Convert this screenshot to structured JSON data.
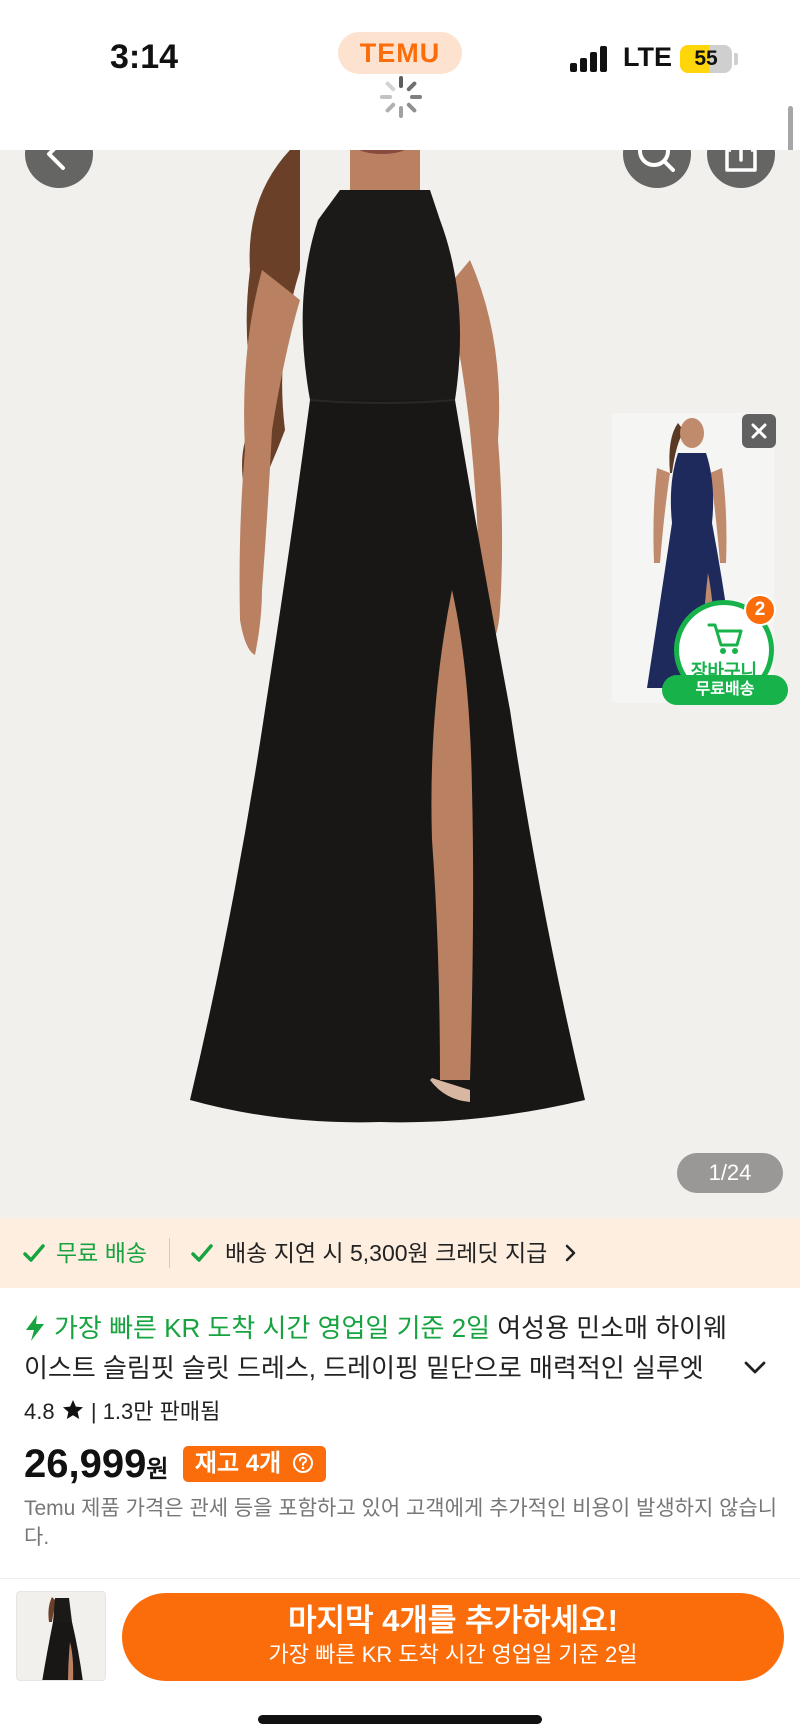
{
  "status_bar": {
    "time": "3:14",
    "brand": "TEMU",
    "network": "LTE",
    "battery": "55",
    "battery_level": 0.55
  },
  "nav": {
    "back_icon": "chevron-left-icon",
    "search_icon": "search-icon",
    "share_icon": "share-icon"
  },
  "gallery": {
    "counter": "1/24"
  },
  "floating": {
    "close_icon": "close-icon",
    "cart_label": "장바구니",
    "cart_count": "2",
    "free_shipping": "무료배송"
  },
  "shipping": {
    "free_shipping": "무료 배송",
    "delay_credit": "배송 지연 시 5,300원 크레딧 지급"
  },
  "product": {
    "fast_arrival": "가장 빠른 KR 도착 시간 영업일 기준 2일",
    "title_part1": "여성용 민소매 하이웨",
    "title_part2": "이스트 슬림핏 슬릿 드레스, 드레이핑 밑단으로 매력적인 실루엣",
    "rating": "4.8",
    "sold": "1.3만 판매됨",
    "price": "26,999",
    "currency": "원",
    "stock": "재고 4개",
    "price_note": "Temu 제품 가격은 관세 등을 포함하고 있어 고객에게 추가적인 비용이 발생하지 않습니다."
  },
  "bottom_bar": {
    "cta_main": "마지막 4개를 추가하세요!",
    "cta_sub": "가장 빠른 KR 도착 시간 영업일 기준 2일"
  },
  "colors": {
    "accent": "#fb6d0a",
    "green": "#17b34a",
    "strip_bg": "#fdeee0"
  }
}
